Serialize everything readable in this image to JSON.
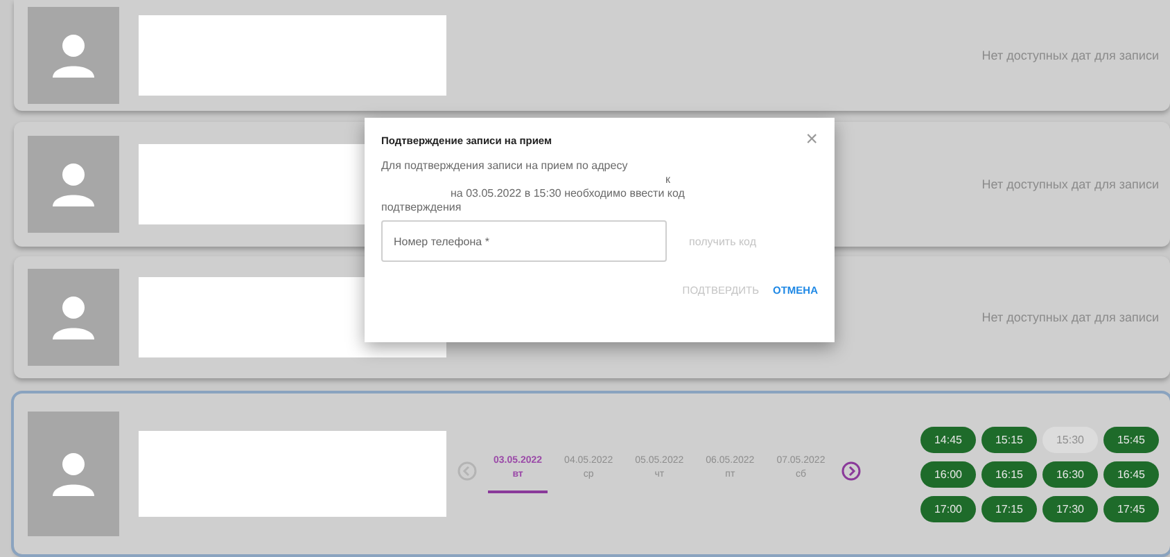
{
  "cards": [
    {
      "kind": "empty",
      "message": "Нет доступных дат для записи",
      "selected": false
    },
    {
      "kind": "empty",
      "message": "Нет доступных дат для записи",
      "selected": false
    },
    {
      "kind": "empty",
      "message": "Нет доступных дат для записи",
      "selected": false
    },
    {
      "kind": "schedule",
      "selected": true,
      "prev_disabled": true,
      "next_disabled": false,
      "dates": [
        {
          "date": "03.05.2022",
          "day": "вт",
          "selected": true
        },
        {
          "date": "04.05.2022",
          "day": "ср",
          "selected": false
        },
        {
          "date": "05.05.2022",
          "day": "чт",
          "selected": false
        },
        {
          "date": "06.05.2022",
          "day": "пт",
          "selected": false
        },
        {
          "date": "07.05.2022",
          "day": "сб",
          "selected": false
        }
      ],
      "slots": [
        {
          "time": "14:45",
          "disabled": false
        },
        {
          "time": "15:15",
          "disabled": false
        },
        {
          "time": "15:30",
          "disabled": true
        },
        {
          "time": "15:45",
          "disabled": false
        },
        {
          "time": "16:00",
          "disabled": false
        },
        {
          "time": "16:15",
          "disabled": false
        },
        {
          "time": "16:30",
          "disabled": false
        },
        {
          "time": "16:45",
          "disabled": false
        },
        {
          "time": "17:00",
          "disabled": false
        },
        {
          "time": "17:15",
          "disabled": false
        },
        {
          "time": "17:30",
          "disabled": false
        },
        {
          "time": "17:45",
          "disabled": false
        }
      ]
    }
  ],
  "dialog": {
    "title": "Подтверждение записи на прием",
    "close": "×",
    "message_lines": [
      "Для подтверждения записи на прием по адресу",
      "к",
      "на 03.05.2022 в 15:30 необходимо ввести код",
      "подтверждения"
    ],
    "phone": {
      "placeholder": "Номер телефона *"
    },
    "get_code": {
      "label": "получить код",
      "disabled": true
    },
    "buttons": [
      {
        "label": "ПОДТВЕРДИТЬ",
        "disabled": true
      },
      {
        "label": "ОТМЕНА",
        "disabled": false
      }
    ]
  }
}
